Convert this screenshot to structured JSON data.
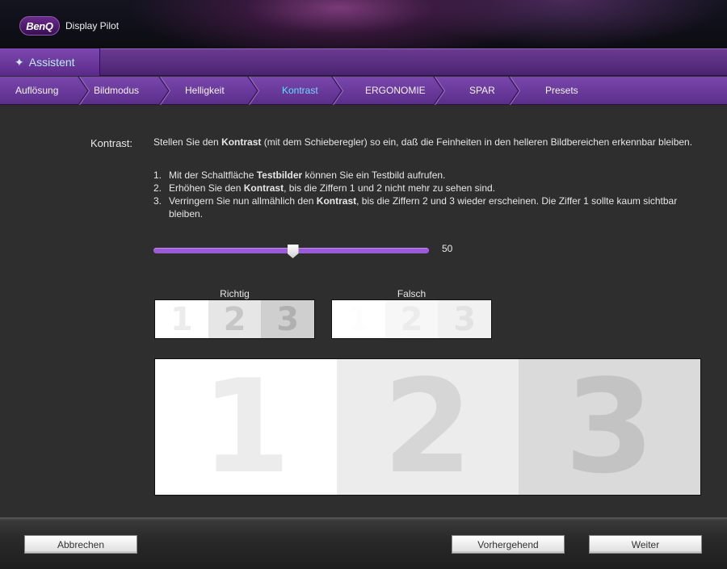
{
  "app": {
    "logo_text": "BenQ",
    "title": "Display Pilot"
  },
  "assistant_tab": {
    "label": "Assistent",
    "icon": "magic-wand-icon"
  },
  "steps": [
    {
      "label": "Auflösung",
      "active": false
    },
    {
      "label": "Bildmodus",
      "active": false
    },
    {
      "label": "Helligkeit",
      "active": false
    },
    {
      "label": "Kontrast",
      "active": true
    },
    {
      "label": "ERGONOMIE",
      "active": false
    },
    {
      "label": "SPAR",
      "active": false
    },
    {
      "label": "Presets",
      "active": false
    }
  ],
  "main": {
    "section_label": "Kontrast:",
    "intro": {
      "pre": "Stellen Sie den ",
      "bold": "Kontrast",
      "post": " (mit dem Schieberegler) so ein, daß die Feinheiten in den helleren Bildbereichen erkennbar bleiben."
    },
    "instructions": [
      {
        "num": "1.",
        "pre": "Mit der Schaltfläche ",
        "bold": "Testbilder",
        "post": " können Sie ein Testbild aufrufen."
      },
      {
        "num": "2.",
        "pre": "Erhöhen Sie den ",
        "bold": "Kontrast",
        "post": ", bis die Ziffern 1 und 2 nicht mehr zu sehen sind."
      },
      {
        "num": "3.",
        "pre": "Verringern Sie nun allmählich den ",
        "bold": "Kontrast",
        "post": ", bis die Ziffern 2 und 3 wieder erscheinen. Die Ziffer 1 sollte kaum sichtbar bleiben."
      }
    ],
    "slider": {
      "value": 50,
      "min": 0,
      "max": 100,
      "value_label": "50"
    },
    "correct_caption": "Richtig",
    "wrong_caption": "Falsch",
    "digits": [
      "1",
      "2",
      "3"
    ]
  },
  "colors": {
    "accent": "#7a47ad",
    "active_step": "#6fd8ff",
    "slider": "#9b5bd8",
    "correct_cells_bg": [
      "#ffffff",
      "#e6e6e6",
      "#cfcfcf"
    ],
    "correct_cells_fg": [
      "#ececec",
      "#c6c6c6",
      "#b0b0b0"
    ],
    "wrong_cells_bg": [
      "#ffffff",
      "#f7f7f7",
      "#f1f1f1"
    ],
    "wrong_cells_fg": [
      "#fdfdfd",
      "#ececec",
      "#e2e2e2"
    ],
    "big_cells_bg": [
      "#ffffff",
      "#ececec",
      "#dadada"
    ],
    "big_cells_fg": [
      "#ececec",
      "#d6d6d6",
      "#c3c3c3"
    ]
  },
  "footer": {
    "cancel": "Abbrechen",
    "previous": "Vorhergehend",
    "next": "Weiter"
  }
}
